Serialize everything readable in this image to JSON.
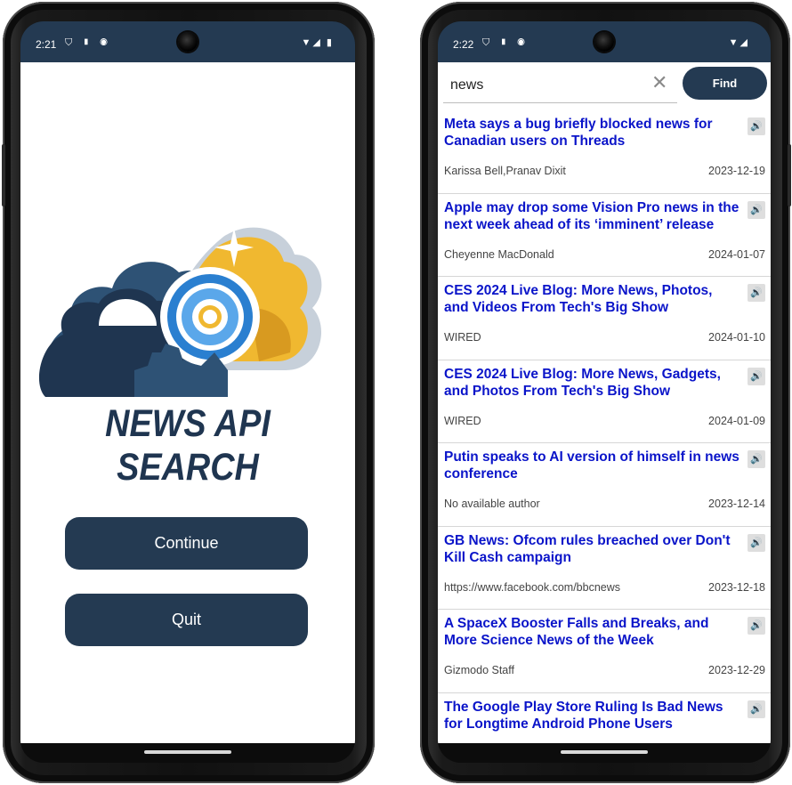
{
  "left_phone": {
    "status": {
      "time": "2:21",
      "icons_left": "⛉ ▮ ◉",
      "icons_right": "▼◢ ▮"
    },
    "logo_text": "NEWS API SEARCH",
    "buttons": {
      "continue": "Continue",
      "quit": "Quit"
    }
  },
  "right_phone": {
    "status": {
      "time": "2:22",
      "icons_left": "⛉ ▮ ◉",
      "icons_right": "▼◢"
    },
    "search": {
      "value": "news",
      "clear_icon": "✕",
      "find_label": "Find"
    },
    "speaker_icon": "🔊",
    "articles": [
      {
        "title": "Meta says a bug briefly blocked news for Canadian users on Threads",
        "author": "Karissa Bell,Pranav Dixit",
        "date": "2023-12-19"
      },
      {
        "title": "Apple may drop some Vision Pro news in the next week ahead of its ‘imminent’ release",
        "author": "Cheyenne MacDonald",
        "date": "2024-01-07"
      },
      {
        "title": "CES 2024 Live Blog: More News, Photos, and Videos From Tech's Big Show",
        "author": "WIRED",
        "date": "2024-01-10"
      },
      {
        "title": "CES 2024 Live Blog: More News, Gadgets, and Photos From Tech's Big Show",
        "author": "WIRED",
        "date": "2024-01-09"
      },
      {
        "title": "Putin speaks to AI version of himself in news conference",
        "author": "No available author",
        "date": "2023-12-14"
      },
      {
        "title": "GB News: Ofcom rules breached over Don't Kill Cash campaign",
        "author": "https://www.facebook.com/bbcnews",
        "date": "2023-12-18"
      },
      {
        "title": "A SpaceX Booster Falls and Breaks, and More Science News of the Week",
        "author": "Gizmodo Staff",
        "date": "2023-12-29"
      },
      {
        "title": "The Google Play Store Ruling Is Bad News for Longtime Android Phone Users",
        "author": "",
        "date": ""
      }
    ]
  }
}
